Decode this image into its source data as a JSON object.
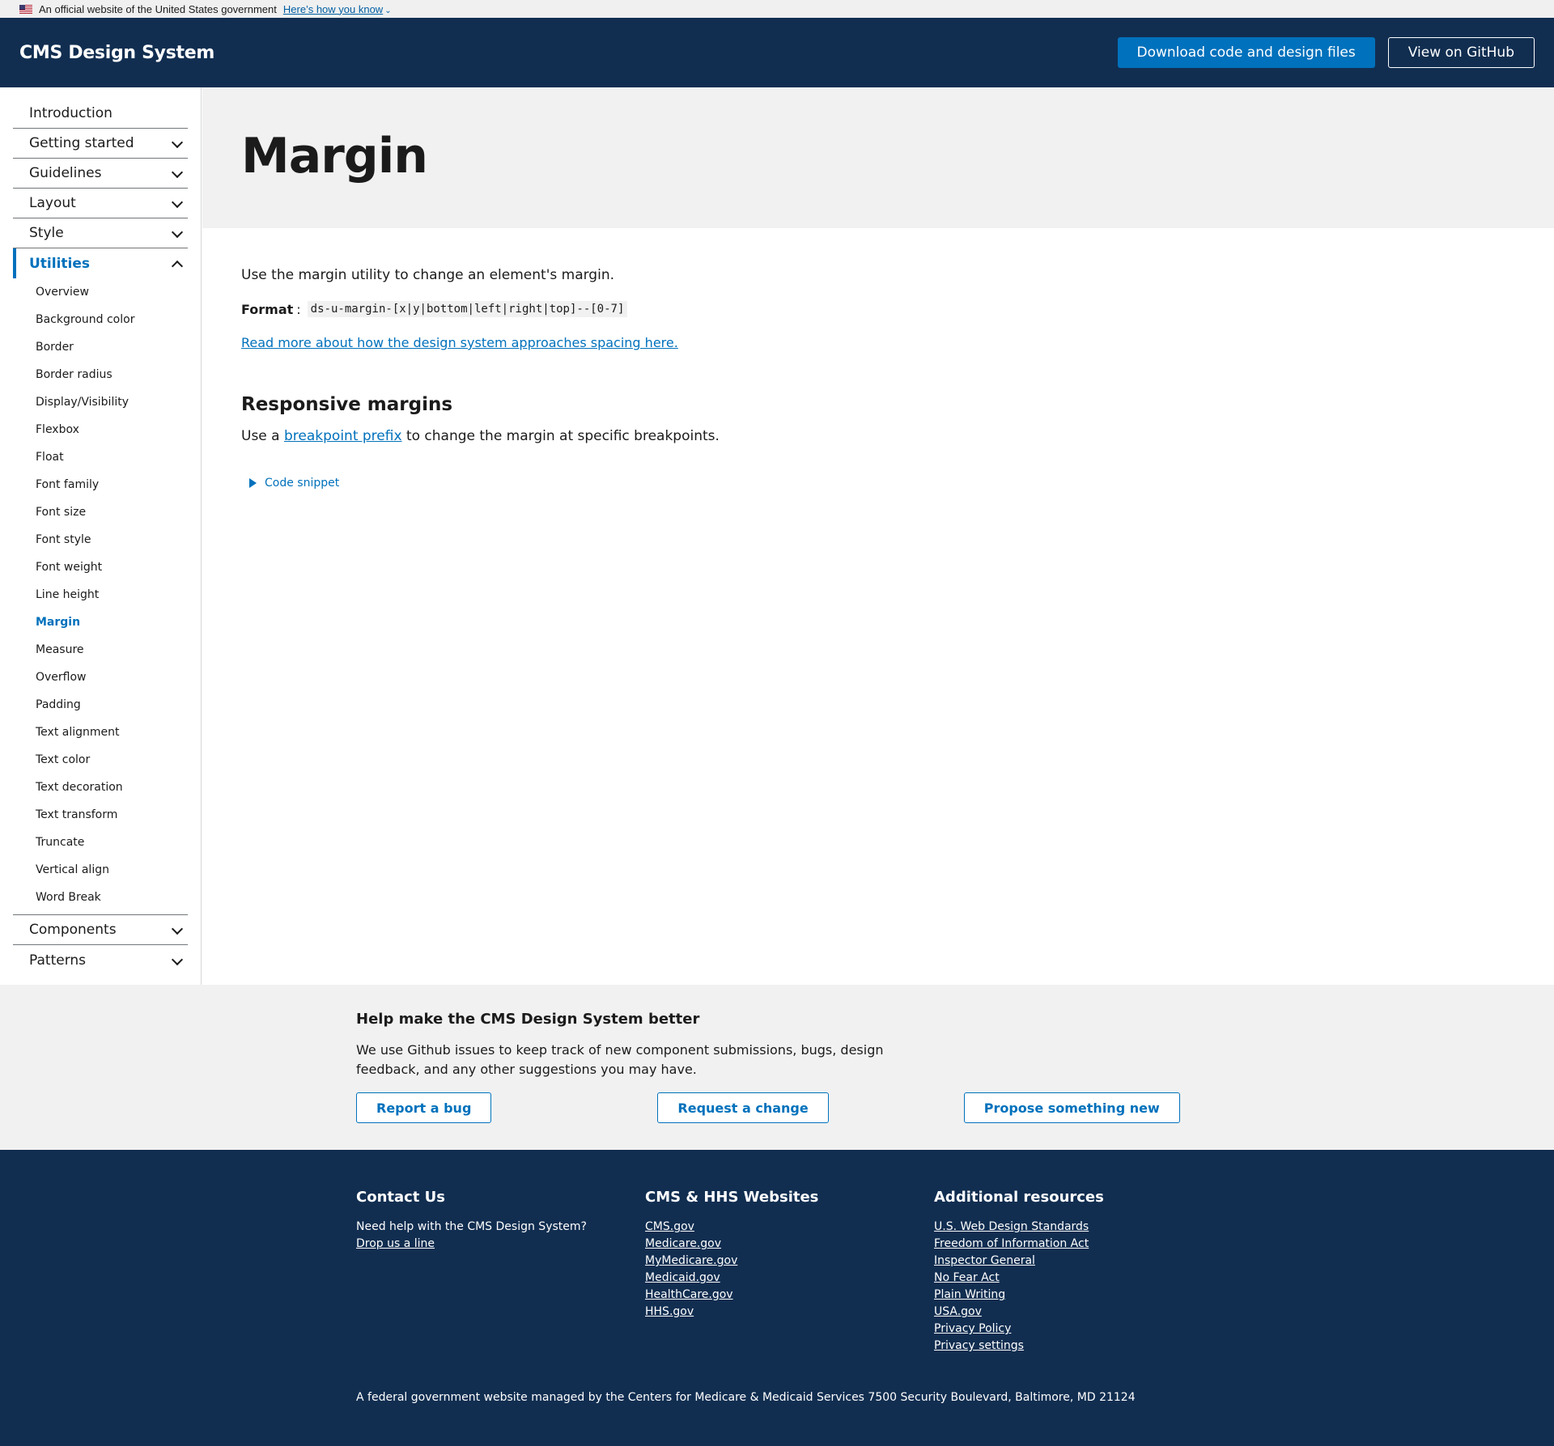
{
  "gov_banner": {
    "text": "An official website of the United States government",
    "link": "Here’s how you know"
  },
  "header": {
    "brand": "CMS Design System",
    "download_label": "Download code and design files",
    "github_label": "View on GitHub"
  },
  "sidebar": {
    "top_items": [
      {
        "label": "Introduction"
      },
      {
        "label": "Getting started"
      },
      {
        "label": "Guidelines"
      },
      {
        "label": "Layout"
      },
      {
        "label": "Style"
      },
      {
        "label": "Utilities"
      },
      {
        "label": "Components"
      },
      {
        "label": "Patterns"
      }
    ],
    "utilities_items": [
      "Overview",
      "Background color",
      "Border",
      "Border radius",
      "Display/Visibility",
      "Flexbox",
      "Float",
      "Font family",
      "Font size",
      "Font style",
      "Font weight",
      "Line height",
      "Margin",
      "Measure",
      "Overflow",
      "Padding",
      "Text alignment",
      "Text color",
      "Text decoration",
      "Text transform",
      "Truncate",
      "Vertical align",
      "Word Break"
    ]
  },
  "main": {
    "title": "Margin",
    "intro": "Use the margin utility to change an element's margin.",
    "format_label": "Format",
    "format_code": "ds-u-margin-[x|y|bottom|left|right|top]--[0-7]",
    "read_more": "Read more about how the design system approaches spacing here.",
    "responsive_heading": "Responsive margins",
    "responsive_before": "Use a",
    "responsive_link": "breakpoint prefix",
    "responsive_after": "to change the margin at specific breakpoints.",
    "code_snippet": "Code snippet"
  },
  "feedback": {
    "heading": "Help make the CMS Design System better",
    "text": "We use Github issues to keep track of new component submissions, bugs, design feedback, and any other suggestions you may have.",
    "report_bug": "Report a bug",
    "request_change": "Request a change",
    "propose_new": "Propose something new"
  },
  "footer": {
    "contact_heading": "Contact Us",
    "contact_text": "Need help with the CMS Design System?",
    "contact_link": "Drop us a line",
    "websites_heading": "CMS & HHS Websites",
    "websites": [
      "CMS.gov",
      "Medicare.gov",
      "MyMedicare.gov",
      "Medicaid.gov",
      "HealthCare.gov",
      "HHS.gov"
    ],
    "resources_heading": "Additional resources",
    "resources": [
      "U.S. Web Design Standards",
      "Freedom of Information Act",
      "Inspector General",
      "No Fear Act",
      "Plain Writing",
      "USA.gov",
      "Privacy Policy",
      "Privacy settings"
    ],
    "bottom_text": "A federal government website managed by the Centers for Medicare & Medicaid Services 7500 Security Boulevard, Baltimore, MD 21124"
  }
}
